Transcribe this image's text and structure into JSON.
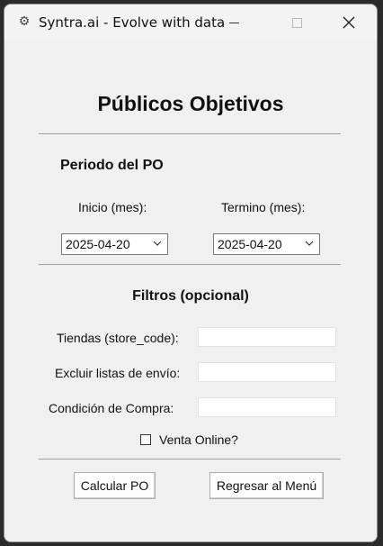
{
  "window": {
    "title": "Syntra.ai - Evolve with data",
    "app_icon": "gear-icon"
  },
  "header": {
    "title": "Públicos Objetivos"
  },
  "periodo": {
    "title": "Periodo del PO",
    "inicio_label": "Inicio (mes):",
    "inicio_value": "2025-04-20",
    "termino_label": "Termino (mes):",
    "termino_value": "2025-04-20"
  },
  "filtros": {
    "title": "Filtros (opcional)",
    "tiendas_label": "Tiendas (store_code):",
    "tiendas_value": "",
    "excluir_label": "Excluir listas de envío:",
    "excluir_value": "",
    "condicion_label": "Condición de Compra:",
    "condicion_value": "",
    "venta_online_label": "Venta Online?",
    "venta_online_checked": false
  },
  "actions": {
    "calcular_label": "Calcular PO",
    "regresar_label": "Regresar al Menú"
  }
}
